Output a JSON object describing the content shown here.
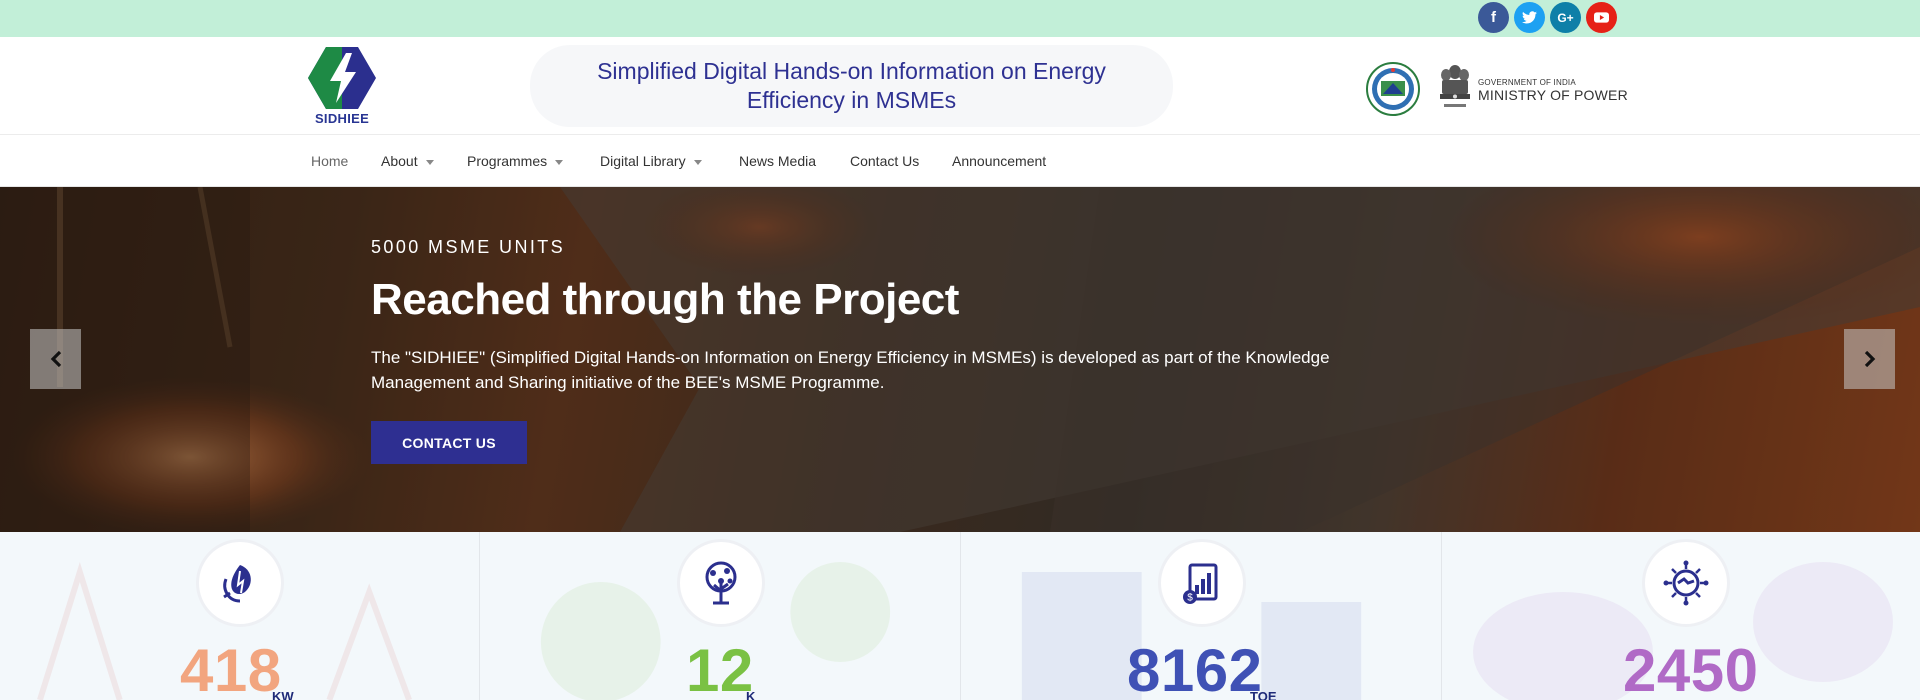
{
  "topbar": {
    "social": [
      {
        "icon": "facebook-icon",
        "glyph": "f"
      },
      {
        "icon": "twitter-icon",
        "glyph": "t"
      },
      {
        "icon": "google-plus-icon",
        "glyph": "G+"
      },
      {
        "icon": "youtube-icon",
        "glyph": "▶"
      }
    ]
  },
  "header": {
    "logo_text": "SIDHIEE",
    "title": "Simplified Digital Hands-on Information on Energy Efficiency in MSMEs",
    "gov_small": "GOVERNMENT OF INDIA",
    "gov_big": "MINISTRY OF POWER"
  },
  "nav": {
    "items": [
      {
        "label": "Home"
      },
      {
        "label": "About"
      },
      {
        "label": "Programmes"
      },
      {
        "label": "Digital Library"
      },
      {
        "label": "News Media"
      },
      {
        "label": "Contact Us"
      },
      {
        "label": "Announcement"
      }
    ]
  },
  "hero": {
    "eyebrow": "5000 MSME UNITS",
    "title": "Reached through the Project",
    "description": "The \"SIDHIEE\" (Simplified Digital Hands-on Information on Energy Efficiency in MSMEs) is developed as part of the Knowledge Management and Sharing initiative of the BEE's MSME Programme.",
    "button": "CONTACT US"
  },
  "stats": [
    {
      "value": "418",
      "unit": "KW",
      "color": "#f2a57f",
      "icon": "renewable-energy-icon"
    },
    {
      "value": "12",
      "unit": "K",
      "color": "#7ac143",
      "icon": "tree-icon"
    },
    {
      "value": "8162",
      "unit": "TOE",
      "color": "#3f51b5",
      "icon": "savings-report-icon"
    },
    {
      "value": "2450",
      "unit": "",
      "color": "#b06ac6",
      "icon": "handshake-network-icon"
    }
  ],
  "colors": {
    "brand_blue": "#2e3192",
    "brand_green": "#1e8a45",
    "topbar": "#c2efd8"
  }
}
